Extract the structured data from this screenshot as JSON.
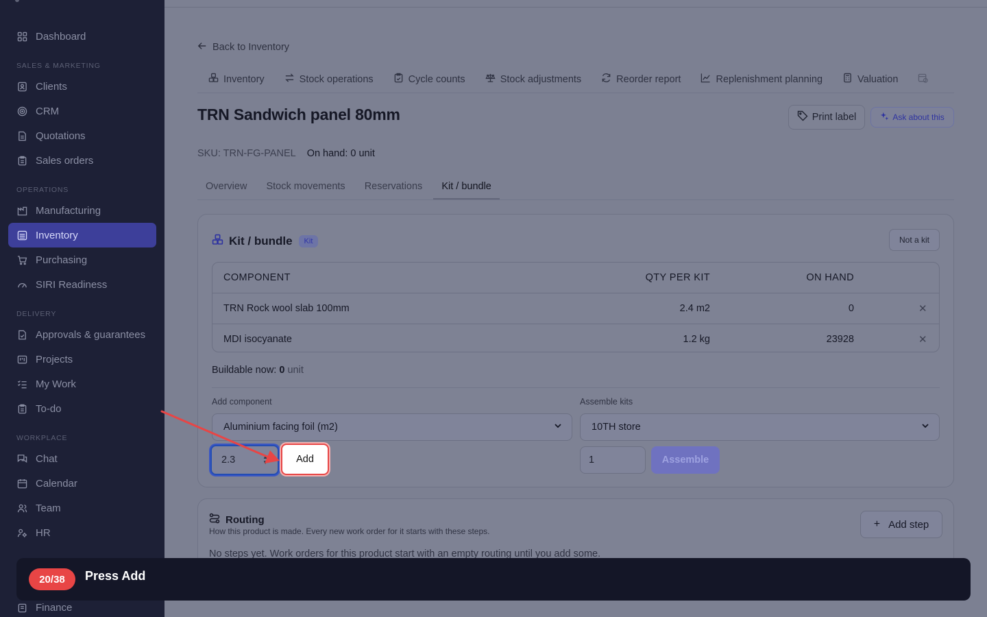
{
  "sidebar": {
    "sections": {
      "sales": "SALES & MARKETING",
      "operations": "OPERATIONS",
      "delivery": "DELIVERY",
      "workplace": "WORKPLACE"
    },
    "items": {
      "dashboard": "Dashboard",
      "clients": "Clients",
      "crm": "CRM",
      "quotations": "Quotations",
      "sales_orders": "Sales orders",
      "manufacturing": "Manufacturing",
      "inventory": "Inventory",
      "purchasing": "Purchasing",
      "siri": "SIRI Readiness",
      "approvals": "Approvals & guarantees",
      "projects": "Projects",
      "my_work": "My Work",
      "todo": "To-do",
      "chat": "Chat",
      "calendar": "Calendar",
      "team": "Team",
      "hr": "HR",
      "finance": "Finance"
    }
  },
  "page": {
    "back_label": "Back to Inventory",
    "subnav": [
      "Inventory",
      "Stock operations",
      "Cycle counts",
      "Stock adjustments",
      "Reorder report",
      "Replenishment planning",
      "Valuation"
    ],
    "title": "TRN Sandwich panel 80mm",
    "print_label": "Print label",
    "ask_label": "Ask about this",
    "sku": "SKU: TRN-FG-PANEL",
    "on_hand": "On hand: 0 unit",
    "tabs": [
      "Overview",
      "Stock movements",
      "Reservations",
      "Kit / bundle"
    ]
  },
  "kit": {
    "title": "Kit / bundle",
    "badge": "Kit",
    "not_kit_label": "Not a kit",
    "columns": {
      "component": "COMPONENT",
      "qty": "QTY PER KIT",
      "on_hand": "ON HAND"
    },
    "rows": [
      {
        "component": "TRN Rock wool slab 100mm",
        "qty": "2.4 m2",
        "on_hand": "0"
      },
      {
        "component": "MDI isocyanate",
        "qty": "1.2 kg",
        "on_hand": "23928"
      }
    ],
    "buildable_label": "Buildable now:",
    "buildable_value": "0",
    "buildable_unit": "unit",
    "add_component_label": "Add component",
    "add_component_selected": "Aluminium facing foil (m2)",
    "qty_value": "2.3",
    "add_button": "Add",
    "assemble_label": "Assemble kits",
    "assemble_store": "10TH store",
    "assemble_qty": "1",
    "assemble_button": "Assemble"
  },
  "routing": {
    "title": "Routing",
    "subtitle": "How this product is made. Every new work order for it starts with these steps.",
    "empty": "No steps yet. Work orders for this product start with an empty routing until you add some.",
    "add_step": "Add step"
  },
  "tour": {
    "count": "20/38",
    "instruction": "Press Add"
  },
  "colors": {
    "accent": "#3d3f9a",
    "highlight": "#e64545",
    "focus": "#234db3"
  }
}
